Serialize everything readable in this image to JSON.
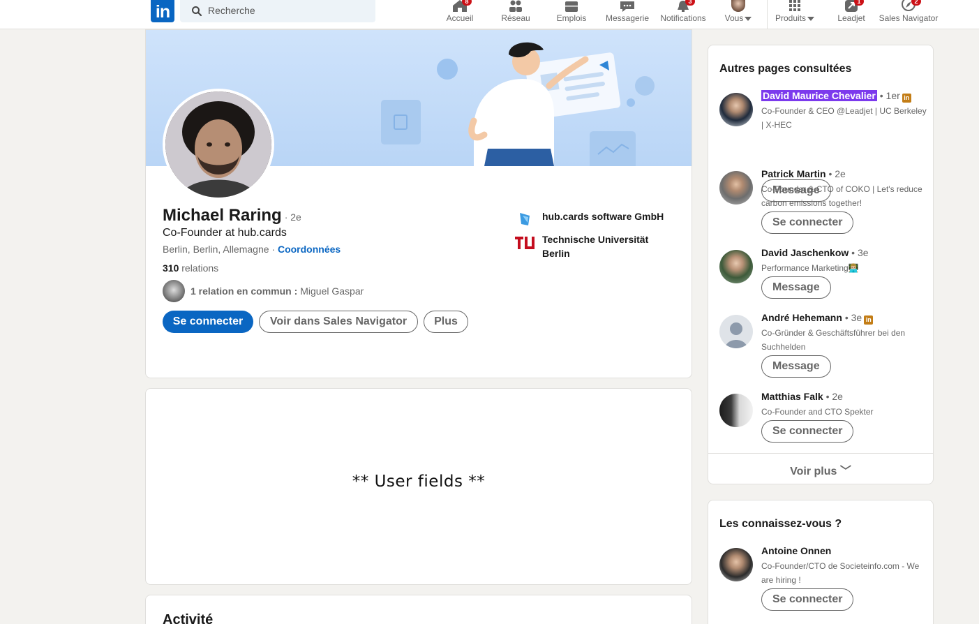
{
  "nav": {
    "search_placeholder": "Recherche",
    "items": [
      {
        "label": "Accueil",
        "badge": "8"
      },
      {
        "label": "Réseau",
        "badge": ""
      },
      {
        "label": "Emplois",
        "badge": ""
      },
      {
        "label": "Messagerie",
        "badge": ""
      },
      {
        "label": "Notifications",
        "badge": "3"
      },
      {
        "label": "Vous",
        "badge": ""
      },
      {
        "label": "Produits",
        "badge": ""
      },
      {
        "label": "Leadjet",
        "badge": "1"
      },
      {
        "label": "Sales Navigator",
        "badge": "2"
      }
    ],
    "brand_color": "#0a66c2"
  },
  "profile": {
    "name": "Michael Raring",
    "degree": "· 2e",
    "headline": "Co-Founder at hub.cards",
    "location": "Berlin, Berlin, Allemagne ·",
    "contact_link": "Coordonnées",
    "relations_count": "310",
    "relations_label": "relations",
    "mutual_bold": "1 relation en commun :",
    "mutual_name": "Miguel Gaspar",
    "buttons": {
      "connect": "Se connecter",
      "sales_nav": "Voir dans Sales Navigator",
      "more": "Plus"
    },
    "company": "hub.cards software GmbH",
    "school": "Technische Universität Berlin"
  },
  "user_fields": {
    "text": "** User fields **"
  },
  "activity": {
    "title": "Activité"
  },
  "rail": {
    "title": "Autres pages consultées",
    "people": [
      {
        "name": "David Maurice Chevalier",
        "degree": "• 1er",
        "headline": "Co-Founder & CEO @Leadjet | UC Berkeley | X-HEC",
        "button": "Message"
      },
      {
        "name": "Patrick Martin",
        "degree": "• 2e",
        "headline": "Co-Founder & CTO of COKO | Let's reduce carbon emissions together!",
        "button": "Se connecter"
      },
      {
        "name": "David Jaschenkow",
        "degree": "• 3e",
        "headline": "Performance Marketing👨🏼‍💻",
        "button": "Message"
      },
      {
        "name": "André Hehemann",
        "degree": "• 3e",
        "headline": "Co-Gründer & Geschäftsführer bei den Suchhelden",
        "button": "Message"
      },
      {
        "name": "Matthias Falk",
        "degree": "• 2e",
        "headline": "Co-Founder and CTO Spekter",
        "button": "Se connecter"
      }
    ],
    "see_more": "Voir plus"
  },
  "rail2": {
    "title": "Les connaissez-vous ?",
    "people": [
      {
        "name": "Antoine Onnen",
        "headline": "Co-Founder/CTO de Societeinfo.com - We are hiring !",
        "button": "Se connecter"
      }
    ]
  },
  "highlight_color": "#7c3aed"
}
